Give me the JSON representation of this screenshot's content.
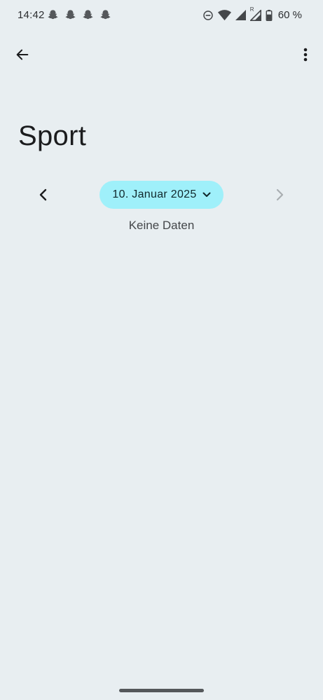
{
  "status_bar": {
    "time": "14:42",
    "battery": "60 %",
    "notification_icons": [
      "snapchat-icon",
      "snapchat-icon",
      "snapchat-icon",
      "snapchat-icon"
    ],
    "system_icons": [
      "do-not-disturb-icon",
      "wifi-icon",
      "signal-icon",
      "signal-roaming-icon",
      "battery-icon"
    ],
    "roaming_label": "R"
  },
  "top_bar": {
    "back_icon": "arrow-back-icon",
    "menu_icon": "more-vert-icon"
  },
  "page": {
    "title": "Sport"
  },
  "date_nav": {
    "date_label": "10. Januar 2025",
    "prev_icon": "chevron-left-icon",
    "next_icon": "chevron-right-icon",
    "dropdown_icon": "chevron-down-icon",
    "chip_color": "#9ff0fa"
  },
  "content": {
    "empty_message": "Keine Daten"
  },
  "colors": {
    "background": "#e8eef1",
    "accent": "#9ff0fa",
    "disabled": "#a9aeb2"
  }
}
